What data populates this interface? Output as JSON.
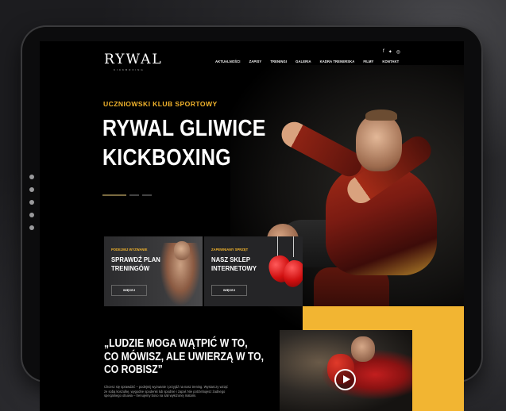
{
  "site": {
    "logo": "RYWAL",
    "logo_sub": "KICKBOXING",
    "nav": [
      "AKTUALNOŚCI",
      "ZAPISY",
      "TRENINGI",
      "GALERIA",
      "KADRA TRENERSKA",
      "FILMY",
      "KONTAKT"
    ],
    "social_icons": [
      "facebook-icon",
      "twitter-icon",
      "instagram-icon"
    ]
  },
  "hero": {
    "eyebrow": "UCZNIOWSKI KLUB SPORTOWY",
    "title_line1": "RYWAL GLIWICE",
    "title_line2": "KICKBOXING"
  },
  "cards": [
    {
      "eyebrow": "PODEJMIJ WYZWANIE",
      "title_line1": "SPRAWDŹ PLAN",
      "title_line2": "TRENINGÓW",
      "button": "WIĘCEJ"
    },
    {
      "eyebrow": "ZAPEWNIAMY SPRZĘT",
      "title_line1": "NASZ SKLEP",
      "title_line2": "INTERNETOWY",
      "button": "WIĘCEJ"
    }
  ],
  "quote": {
    "line1": "„LUDZIE MOGA WĄTPIĆ W TO,",
    "line2": "CO MÓWISZ, ALE UWIERZĄ W TO,",
    "line3": "CO ROBISZ”"
  },
  "body_text": "Chcesz się sprawdzić – podejmij wyzwanie i przyjdź na nasz trening. Wystarczy wziąć ze sobą koszulkę, wygodne spodenki lub spodnie i zapał. Nie potrzebujesz żadnego specjalnego obuwia – trenujemy boso na sali wyłożonej matami.",
  "colors": {
    "accent": "#f2b532",
    "background": "#000000"
  }
}
